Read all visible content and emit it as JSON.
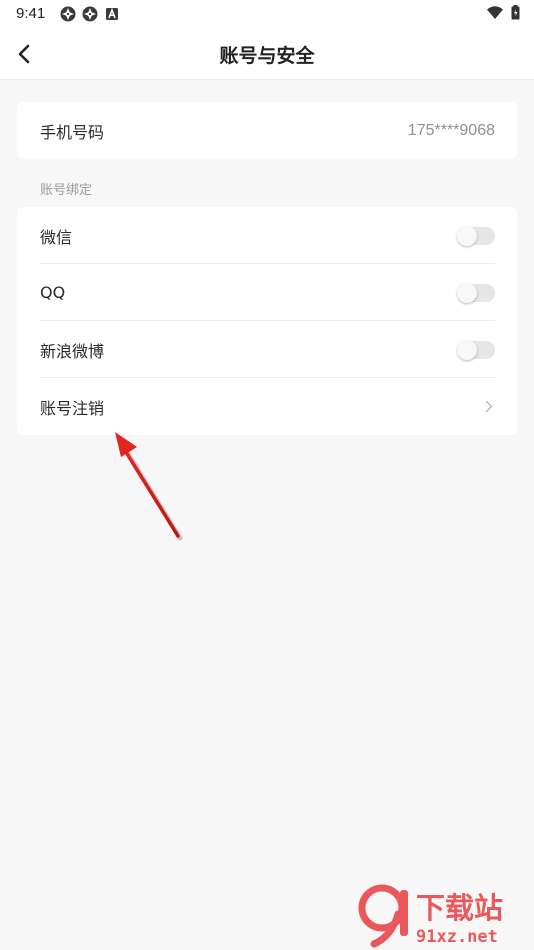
{
  "status_bar": {
    "time": "9:41",
    "left_icons": [
      "app-notification-icon",
      "app-notification-icon",
      "a-badge-icon"
    ],
    "right_icons": [
      "wifi-icon",
      "battery-icon"
    ]
  },
  "header": {
    "title": "账号与安全",
    "back_icon": "chevron-left-icon"
  },
  "phone": {
    "label": "手机号码",
    "value": "175****9068"
  },
  "binding_section": {
    "label": "账号绑定",
    "items": [
      {
        "label": "微信",
        "control": "toggle",
        "on": false
      },
      {
        "label": "QQ",
        "control": "toggle",
        "on": false
      },
      {
        "label": "新浪微博",
        "control": "toggle",
        "on": false
      },
      {
        "label": "账号注销",
        "control": "chevron-right-icon"
      }
    ]
  },
  "annotation": {
    "type": "red-arrow",
    "color": "#e0261f",
    "points_to": "账号注销"
  },
  "watermark": {
    "brand": "下载站",
    "site": "91xz.net",
    "color": "#e8474b"
  }
}
